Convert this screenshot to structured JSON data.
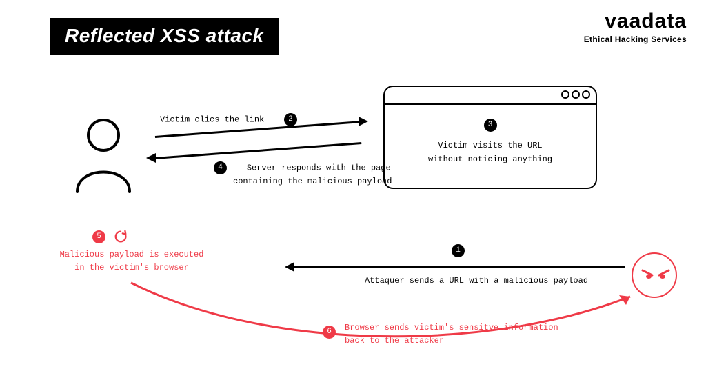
{
  "title": "Reflected XSS attack",
  "brand": {
    "name": "vaadata",
    "tag": "Ethical Hacking Services"
  },
  "steps": {
    "s1": {
      "num": "1",
      "text": "Attaquer sends a URL with a malicious payload"
    },
    "s2": {
      "num": "2",
      "text": "Victim clics the link"
    },
    "s3": {
      "num": "3",
      "line1": "Victim visits the URL",
      "line2": "without noticing anything"
    },
    "s4": {
      "num": "4",
      "line1": "Server responds with the page",
      "line2": "containing the malicious payload"
    },
    "s5": {
      "num": "5",
      "line1": "Malicious payload is executed",
      "line2": "in the victim's browser"
    },
    "s6": {
      "num": "6",
      "line1": "Browser sends victim's sensitve information",
      "line2": "back to the attacker"
    }
  },
  "colors": {
    "accent": "#ef3a47",
    "fg": "#000000",
    "bg": "#ffffff"
  }
}
